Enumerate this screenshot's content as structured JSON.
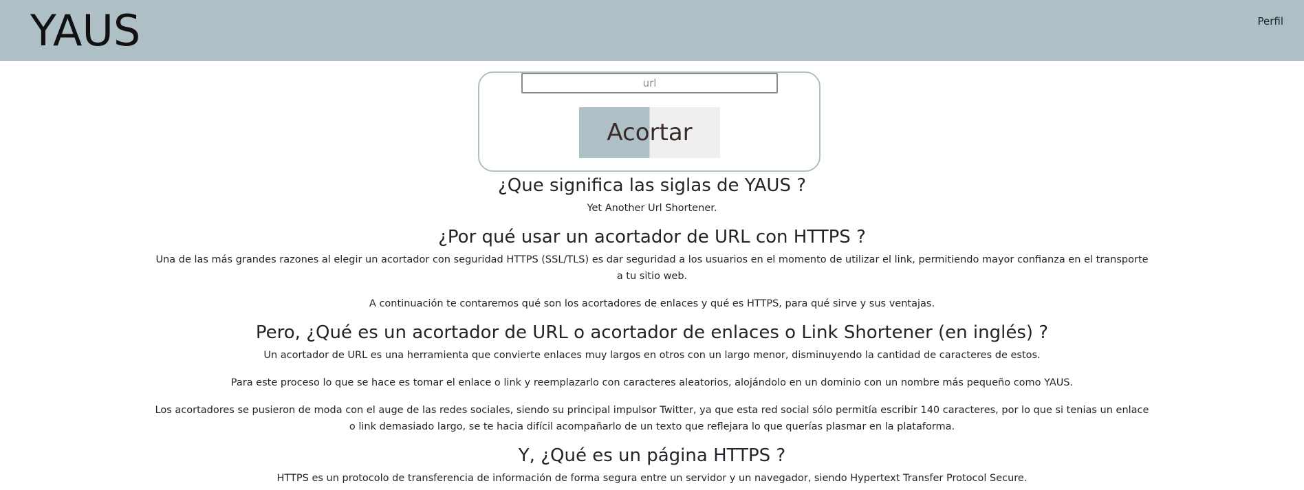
{
  "navbar": {
    "brand": "YAUS",
    "profile_link": "Perfil"
  },
  "shortener": {
    "url_placeholder": "url",
    "submit_label": "Acortar"
  },
  "sections": [
    {
      "heading": "¿Que significa las siglas de YAUS ?",
      "paragraphs": [
        "Yet Another Url Shortener."
      ]
    },
    {
      "heading": "¿Por qué usar un acortador de URL con HTTPS ?",
      "paragraphs": [
        "Una de las más grandes razones al elegir un acortador con seguridad HTTPS (SSL/TLS) es dar seguridad a los usuarios en el momento de utilizar el link, permitiendo mayor confianza en el transporte a tu sitio web.",
        "A continuación te contaremos qué son los acortadores de enlaces y qué es HTTPS, para qué sirve y sus ventajas."
      ]
    },
    {
      "heading": "Pero, ¿Qué es un acortador de URL o acortador de enlaces o Link Shortener (en inglés) ?",
      "paragraphs": [
        "Un acortador de URL es una herramienta que convierte enlaces muy largos en otros con un largo menor, disminuyendo la cantidad de caracteres de estos.",
        "Para este proceso lo que se hace es tomar el enlace o link y reemplazarlo con caracteres aleatorios, alojándolo en un dominio con un nombre más pequeño como YAUS.",
        "Los acortadores se pusieron de moda con el auge de las redes sociales, siendo su principal impulsor Twitter, ya que esta red social sólo permitía escribir 140 caracteres, por lo que si tenias un enlace o link demasiado largo, se te hacia difícil acompañarlo de un texto que reflejara lo que querías plasmar en la plataforma."
      ]
    },
    {
      "heading": "Y, ¿Qué es un página HTTPS ?",
      "paragraphs": [
        "HTTPS es un protocolo de transferencia de información de forma segura entre un servidor y un navegador, siendo Hypertext Transfer Protocol Secure."
      ]
    }
  ]
}
